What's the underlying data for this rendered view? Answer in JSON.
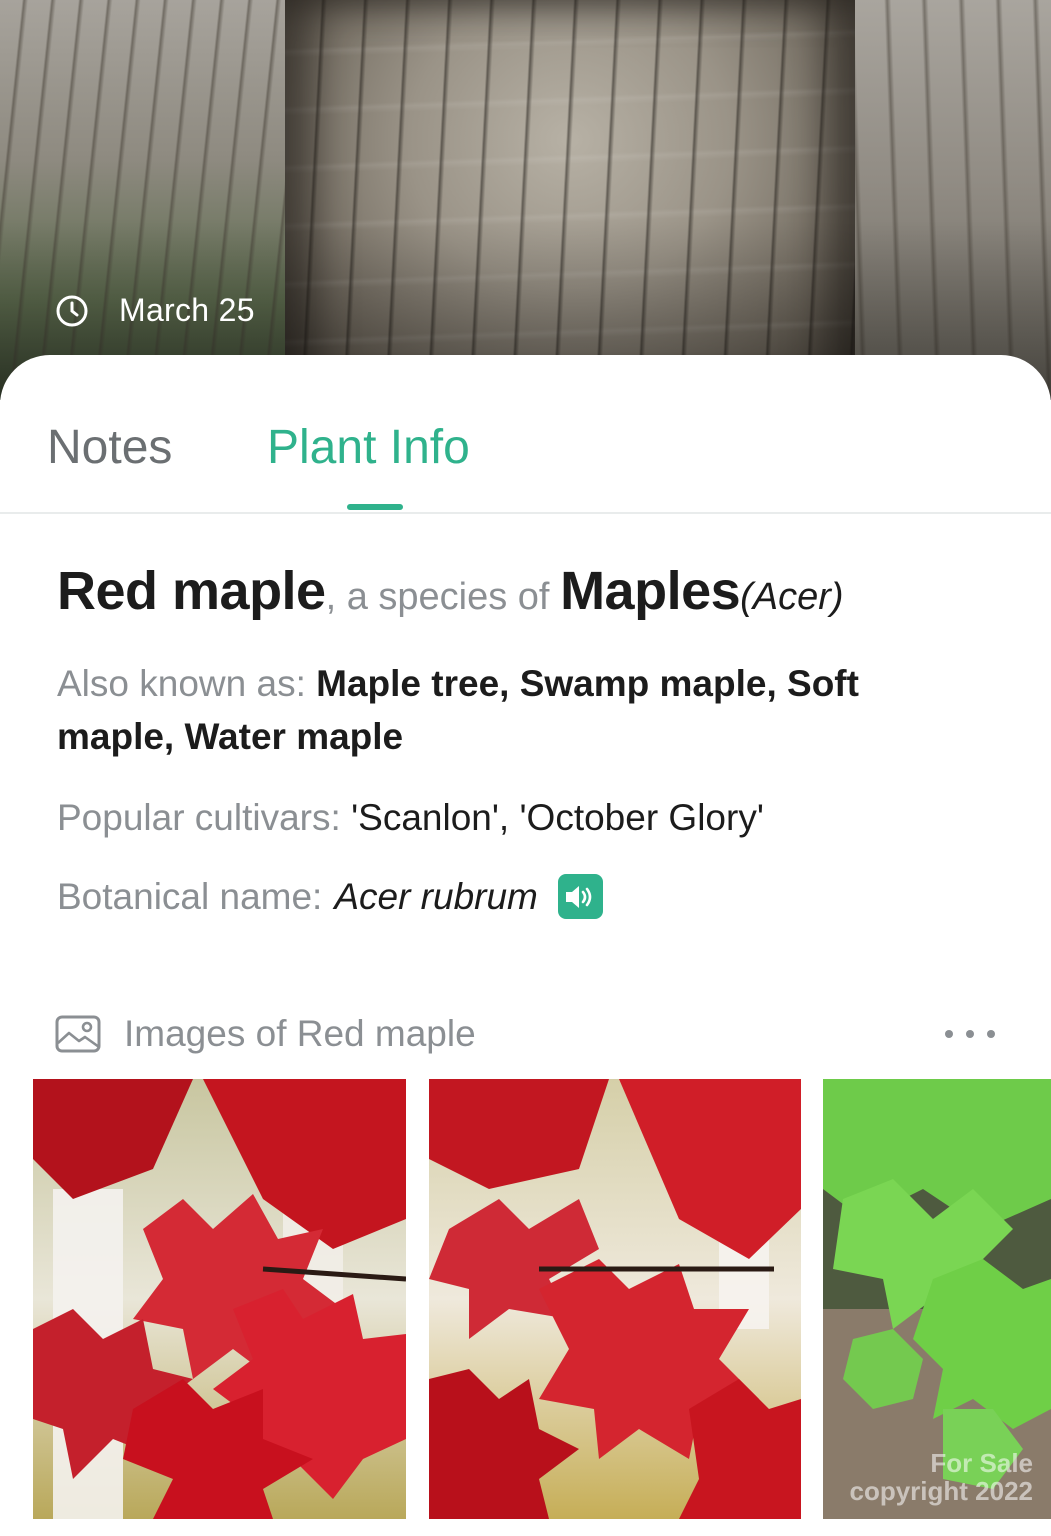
{
  "hero": {
    "date": "March 25",
    "icon": "clock-icon"
  },
  "tabs": [
    {
      "label": "Notes",
      "active": false
    },
    {
      "label": "Plant Info",
      "active": true
    }
  ],
  "accent_color": "#2fb28c",
  "species": {
    "common_name": "Red maple",
    "connector": ", a species of ",
    "genus_common": "Maples",
    "genus_latin": "(Acer)"
  },
  "also_known_as": {
    "label": "Also known as: ",
    "value": "Maple tree, Swamp maple, Soft maple, Water maple"
  },
  "popular_cultivars": {
    "label": "Popular cultivars: ",
    "value": "'Scanlon', 'October Glory'"
  },
  "botanical_name": {
    "label": "Botanical name: ",
    "value": "Acer rubrum",
    "icon": "speaker-icon"
  },
  "images_section": {
    "title": "Images of Red maple",
    "icon": "gallery-icon",
    "more_icon": "more-horizontal-icon",
    "thumbnails": [
      {
        "subject": "red maple leaves"
      },
      {
        "subject": "red maple leaves"
      },
      {
        "subject": "green maple leaves",
        "watermark_line1": "For Sale",
        "watermark_line2": "copyright 2022"
      }
    ]
  }
}
